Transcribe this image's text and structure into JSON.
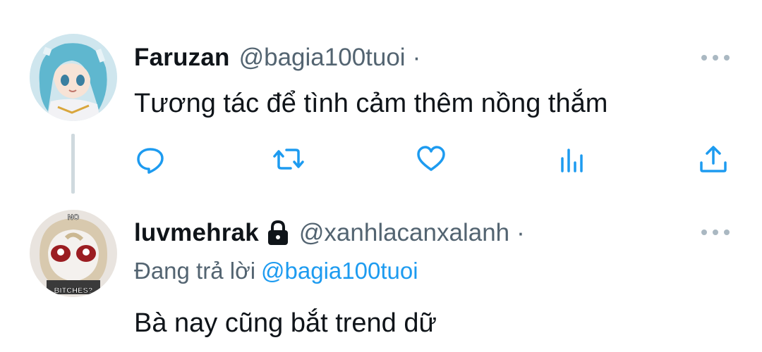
{
  "tweets": [
    {
      "display_name": "Faruzan",
      "handle": "@bagia100tuoi",
      "separator": "·",
      "text": "Tương tác để tình cảm thêm nồng thắm",
      "avatar_icon": "anime-character-avatar",
      "actions": [
        "reply-icon",
        "retweet-icon",
        "like-icon",
        "analytics-icon",
        "share-icon"
      ],
      "more_icon": "more-options-icon"
    },
    {
      "display_name": "luvmehrak",
      "protected_icon": "lock-icon",
      "handle": "@xanhlacanxalanh",
      "separator": "·",
      "reply_prefix": "Đang trả lời",
      "reply_mention": "@bagia100tuoi",
      "text": "Bà nay cũng bắt trend dữ",
      "avatar_icon": "plush-character-avatar",
      "avatar_caption_top": "NO",
      "avatar_caption_bottom": "BITCHES?",
      "more_icon": "more-options-icon"
    }
  ],
  "colors": {
    "text": "#0f1419",
    "secondary": "#536471",
    "accent": "#1d9bf0",
    "thread_line": "#cfd9de",
    "icon": "#1d9bf0"
  }
}
